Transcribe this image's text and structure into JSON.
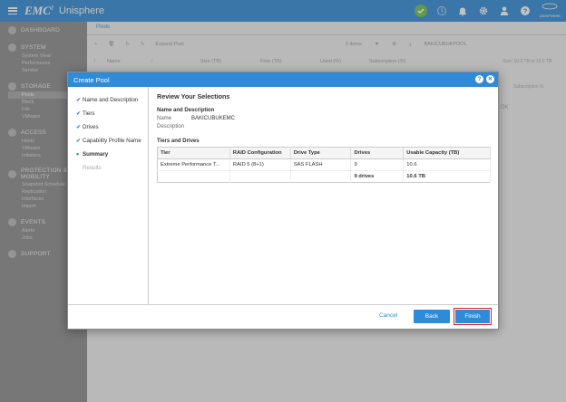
{
  "header": {
    "brand": "EMC",
    "brand_mark": "2",
    "product": "Unisphere",
    "logo_text": "UNISPHERE"
  },
  "sidebar": {
    "groups": [
      {
        "title": "DASHBOARD",
        "icon": "dashboard-icon",
        "items": []
      },
      {
        "title": "SYSTEM",
        "icon": "system-icon",
        "items": [
          "System View",
          "Performance",
          "Service"
        ]
      },
      {
        "title": "STORAGE",
        "icon": "storage-icon",
        "items": [
          "Pools",
          "Block",
          "File",
          "VMware"
        ],
        "active": "Pools"
      },
      {
        "title": "ACCESS",
        "icon": "access-icon",
        "items": [
          "Hosts",
          "VMware",
          "Initiators"
        ]
      },
      {
        "title": "PROTECTION & MOBILITY",
        "icon": "protection-icon",
        "items": [
          "Snapshot Schedule",
          "Replication",
          "Interfaces",
          "Import"
        ]
      },
      {
        "title": "EVENTS",
        "icon": "events-icon",
        "items": [
          "Alerts",
          "Jobs"
        ]
      },
      {
        "title": "SUPPORT",
        "icon": "support-icon",
        "items": []
      }
    ]
  },
  "main": {
    "tab": "Pools",
    "toolbar": [
      "+",
      "🗑",
      "↻",
      "✎",
      "Expand Pool"
    ],
    "toolbar_right": [
      "0 items",
      "▼",
      "⚙",
      "⤓",
      "BAKICUBUKPOOL"
    ],
    "columns": [
      "!",
      "Name",
      "↑",
      "Size (TB)",
      "Free (TB)",
      "Used (%)",
      "Subscription (%)"
    ],
    "aside": "Size: 10.6 TB of 10.6 TB",
    "aside2": "Subscription %",
    "ok_text": "OK"
  },
  "modal": {
    "title": "Create Pool",
    "steps": [
      {
        "label": "Name and Description",
        "state": "done"
      },
      {
        "label": "Tiers",
        "state": "done"
      },
      {
        "label": "Drives",
        "state": "done"
      },
      {
        "label": "Capability Profile Name",
        "state": "done"
      },
      {
        "label": "Summary",
        "state": "current"
      },
      {
        "label": "Results",
        "state": "pending"
      }
    ],
    "review_title": "Review Your Selections",
    "name_section": "Name and Description",
    "name_label": "Name",
    "name_value": "BAKICUBUKEMC",
    "desc_label": "Description",
    "desc_value": "",
    "tiers_section": "Tiers and Drives",
    "table": {
      "headers": [
        "Tier",
        "RAID Configuration",
        "Drive Type",
        "Drives",
        "Usable Capacity (TB)"
      ],
      "rows": [
        [
          "Extreme Performance T...",
          "RAID 5 (8+1)",
          "SAS FLASH",
          "9",
          "10.6"
        ]
      ],
      "total": [
        "",
        "",
        "",
        "9 drives",
        "10.6 TB"
      ]
    },
    "buttons": {
      "cancel": "Cancel",
      "back": "Back",
      "finish": "Finish"
    }
  }
}
